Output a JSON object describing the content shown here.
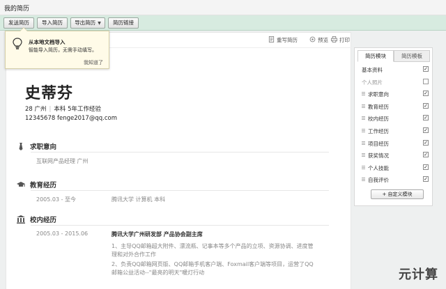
{
  "window": {
    "title": "我的简历"
  },
  "toolbar": {
    "send": "发送简历",
    "import": "导入简历",
    "export": "导出简历",
    "link": "简历链接"
  },
  "paper_tools": {
    "rewrite": "重写简历",
    "preview": "预览",
    "print": "打印"
  },
  "tooltip": {
    "title": "从本地文档导入",
    "body": "智能导入简历，无需手动填写。",
    "dismiss": "我知道了"
  },
  "resume": {
    "name": "史蒂芬",
    "age": "28",
    "city": "广州",
    "degree": "本科",
    "experience": "5年工作经验",
    "phone": "12345678",
    "email": "fenge2017@qq.com",
    "sections": {
      "intent": {
        "title": "求职意向",
        "text": "互联网产品经理  广州"
      },
      "education": {
        "title": "教育经历",
        "period": "2005.03 - 至今",
        "school": "腾讯大学  计算机  本科"
      },
      "campus": {
        "title": "校内经历",
        "period": "2005.03 - 2015.06",
        "org": "腾讯大学广州研发部   产品协会副主席",
        "line1": "1、主导QQ邮箱超大附件、漂流瓶、记事本等多个产品的立项、资源协调、进度管",
        "line1b": "理和对外合作工作",
        "line2": "2、负责QQ邮箱网页版、QQ邮箱手机客户端、Foxmail客户端等项目，运营了QQ",
        "line2b": "邮箱公益活动--\"最亮的明天\"暖灯行动"
      }
    }
  },
  "panel": {
    "tab_modules": "简历模块",
    "tab_templates": "简历模板",
    "items": [
      {
        "label": "基本资料",
        "checked": true,
        "draggable": false,
        "muted": false
      },
      {
        "label": "个人照片",
        "checked": false,
        "draggable": false,
        "muted": true
      },
      {
        "label": "求职意向",
        "checked": true,
        "draggable": true,
        "muted": false
      },
      {
        "label": "教育经历",
        "checked": true,
        "draggable": true,
        "muted": false
      },
      {
        "label": "校内经历",
        "checked": true,
        "draggable": true,
        "muted": false
      },
      {
        "label": "工作经历",
        "checked": true,
        "draggable": true,
        "muted": false
      },
      {
        "label": "项目经历",
        "checked": true,
        "draggable": true,
        "muted": false
      },
      {
        "label": "获奖情况",
        "checked": true,
        "draggable": true,
        "muted": false
      },
      {
        "label": "个人技能",
        "checked": true,
        "draggable": true,
        "muted": false
      },
      {
        "label": "自我评价",
        "checked": true,
        "draggable": true,
        "muted": false
      }
    ],
    "custom_button": "+ 自定义模块",
    "check_glyph": "✓"
  },
  "watermark": "元计算"
}
